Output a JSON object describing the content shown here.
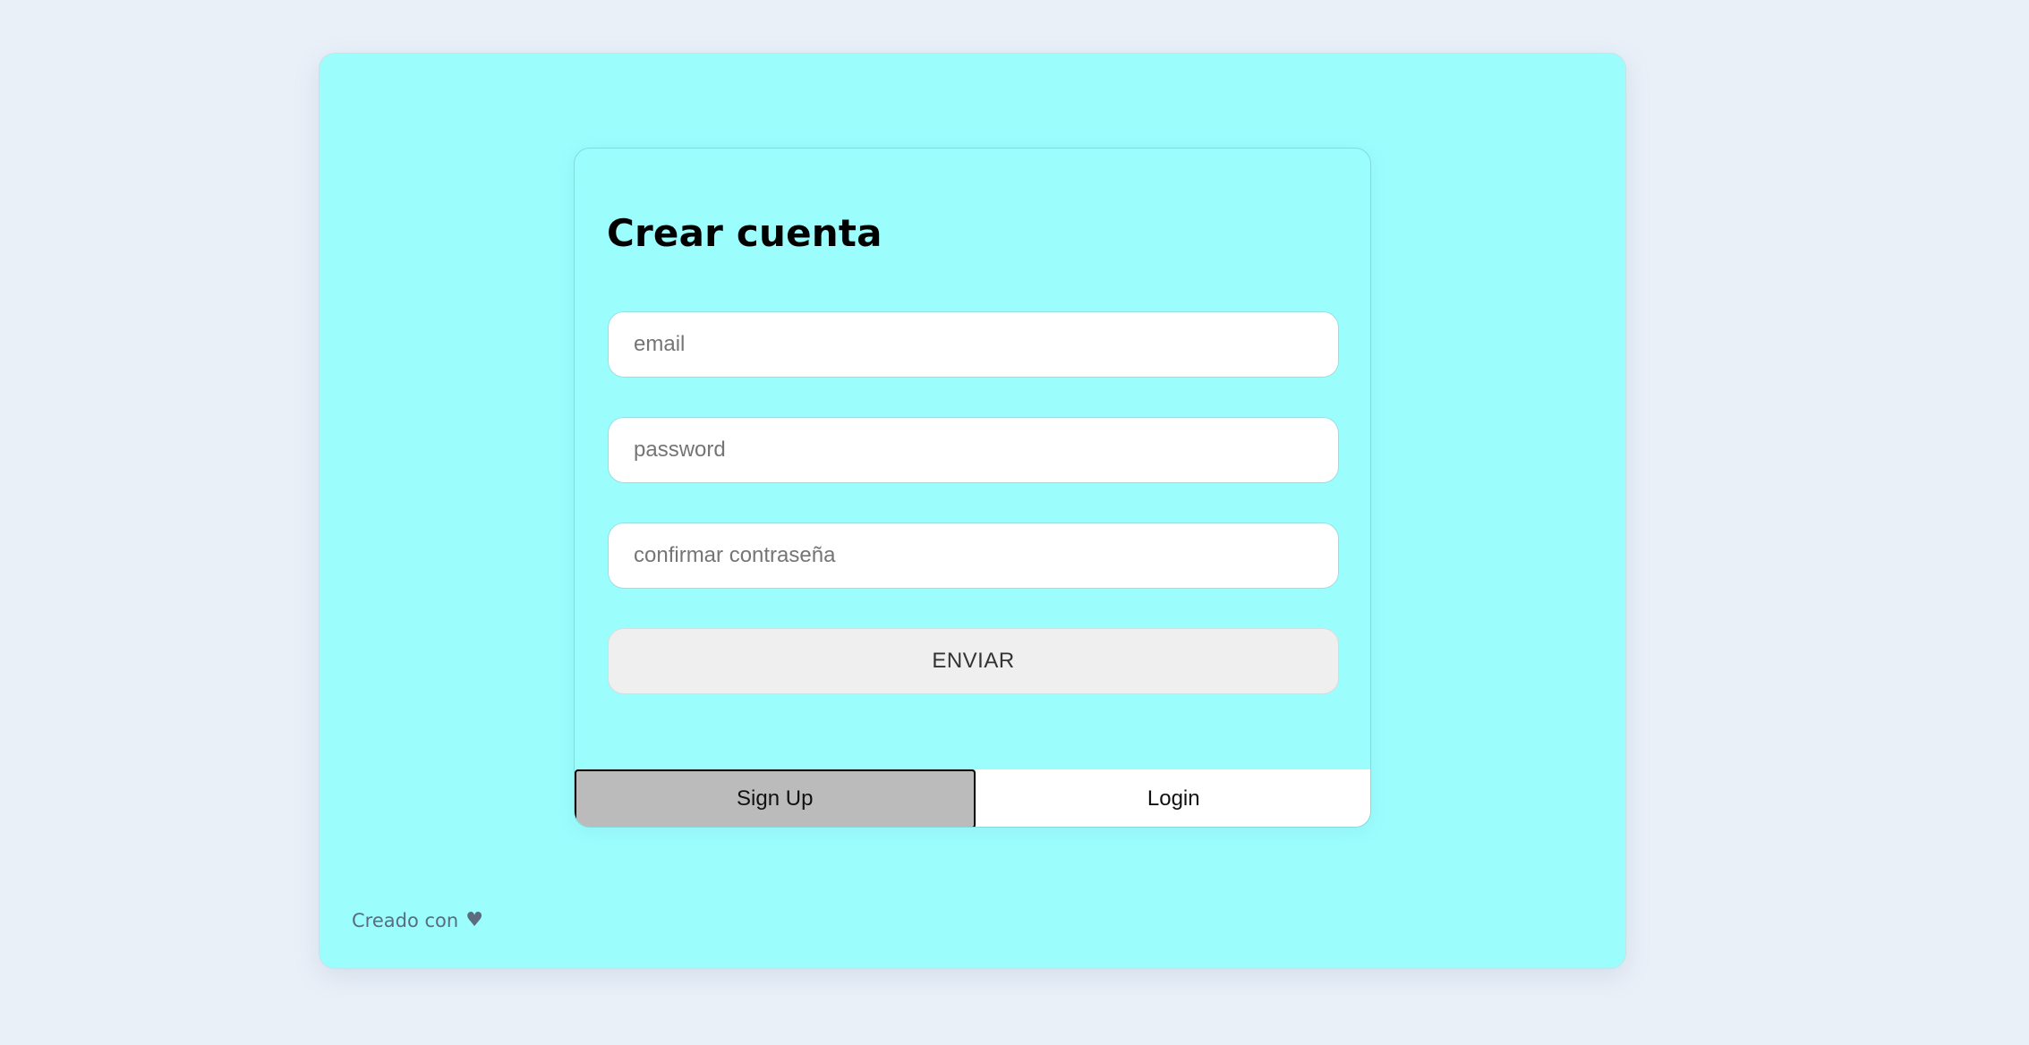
{
  "form": {
    "title": "Crear cuenta",
    "email_placeholder": "email",
    "password_placeholder": "password",
    "confirm_placeholder": "confirmar contraseña",
    "submit_label": "ENVIAR"
  },
  "tabs": {
    "signup_label": "Sign Up",
    "login_label": "Login",
    "active": "signup"
  },
  "footer": {
    "text": "Creado con",
    "icon": "heart-icon"
  },
  "colors": {
    "background": "#e9f0f8",
    "panel": "#9cfdfd",
    "active_tab": "#bbbbbb",
    "button": "#efefef"
  }
}
